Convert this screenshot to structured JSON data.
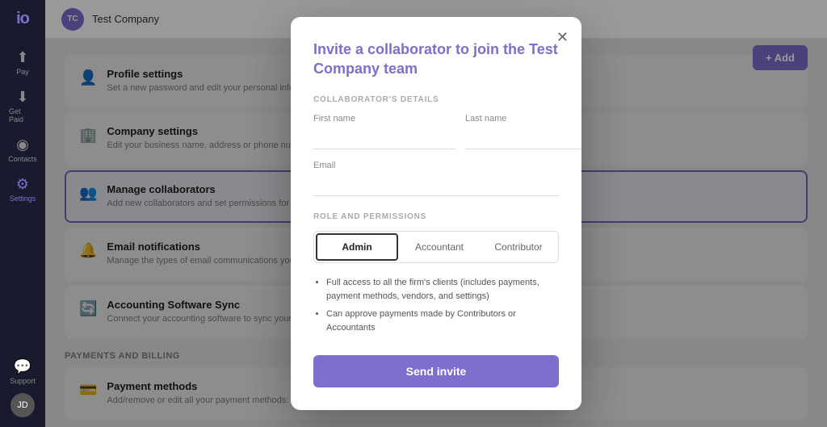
{
  "sidebar": {
    "logo": "io",
    "items": [
      {
        "id": "pay",
        "label": "Pay",
        "icon": "↑",
        "active": false
      },
      {
        "id": "get-paid",
        "label": "Get Paid",
        "icon": "↓",
        "active": false
      },
      {
        "id": "contacts",
        "label": "Contacts",
        "icon": "👤",
        "active": false
      },
      {
        "id": "settings",
        "label": "Settings",
        "icon": "⚙",
        "active": true
      },
      {
        "id": "support",
        "label": "Support",
        "icon": "💬",
        "active": false
      }
    ],
    "avatar_initials": "JD"
  },
  "topbar": {
    "company_initials": "TC",
    "company_name": "Test Company"
  },
  "settings": {
    "section_title": "PAYMENTS AND BILLING",
    "cards": [
      {
        "id": "profile",
        "icon": "👤",
        "title": "Profile settings",
        "desc": "Set a new password and edit your personal information.",
        "active": false
      },
      {
        "id": "company",
        "icon": "🏢",
        "title": "Company settings",
        "desc": "Edit your business name, address or phone number. Update your business's legal information.",
        "active": false
      },
      {
        "id": "collaborators",
        "icon": "👥",
        "title": "Manage collaborators",
        "desc": "Add new collaborators and set permissions for team members and others.",
        "active": true
      },
      {
        "id": "email",
        "icon": "🔔",
        "title": "Email notifications",
        "desc": "Manage the types of email communications you'd like to receive.",
        "active": false
      },
      {
        "id": "accounting",
        "icon": "🔄",
        "title": "Accounting Software Sync",
        "desc": "Connect your accounting software to sync your invoices, contacts, and payments with Melio.",
        "active": false
      }
    ],
    "billing_section": "PAYMENTS AND BILLING",
    "billing_cards": [
      {
        "id": "payment-methods",
        "icon": "💳",
        "title": "Payment methods",
        "desc": "Add/remove or edit all your payment methods: bank accounts, credit or debit cards.",
        "active": false
      }
    ],
    "add_button_label": "+ Add"
  },
  "modal": {
    "title_prefix": "Invite a collaborator to join the ",
    "title_company": "Test Company",
    "title_suffix": " team",
    "collaborator_section": "COLLABORATOR'S DETAILS",
    "first_name_label": "First name",
    "last_name_label": "Last name",
    "email_label": "Email",
    "role_section": "ROLE AND PERMISSIONS",
    "roles": [
      {
        "id": "admin",
        "label": "Admin",
        "active": true
      },
      {
        "id": "accountant",
        "label": "Accountant",
        "active": false
      },
      {
        "id": "contributor",
        "label": "Contributor",
        "active": false
      }
    ],
    "role_description": [
      "Full access to all the firm's clients (includes payments, payment methods, vendors, and settings)",
      "Can approve payments made by Contributors or Accountants"
    ],
    "send_button_label": "Send invite"
  }
}
